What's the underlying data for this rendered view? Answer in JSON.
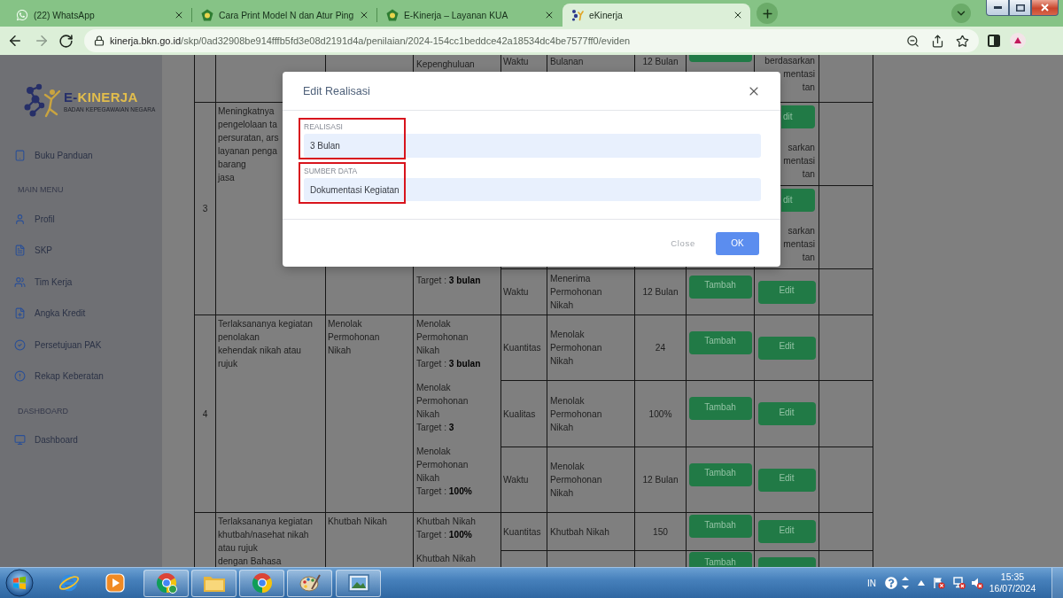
{
  "browser": {
    "tabs": [
      {
        "title": "(22) WhatsApp",
        "selected": false
      },
      {
        "title": "Cara Print Model N dan Atur Ping",
        "selected": false
      },
      {
        "title": "E-Kinerja – Layanan KUA",
        "selected": false
      },
      {
        "title": "eKinerja",
        "selected": true
      }
    ],
    "url": {
      "host": "kinerja.bkn.go.id",
      "path": "/skp/0ad32908be914fffb5fd3e08d2191d4a/penilaian/2024-154cc1beddce42a18534dc4be7577ff0/eviden"
    }
  },
  "sidebar": {
    "logo": {
      "title_parts": [
        {
          "text": "E-",
          "color": "#27306a"
        },
        {
          "text": "KINERJA",
          "color": "#e2bd4c"
        }
      ],
      "subtitle": "BADAN KEPEGAWAIAN NEGARA"
    },
    "items": [
      {
        "kind": "link",
        "label": "Buku Panduan"
      },
      {
        "kind": "header",
        "label": "MAIN MENU"
      },
      {
        "kind": "link",
        "label": "Profil"
      },
      {
        "kind": "link",
        "label": "SKP"
      },
      {
        "kind": "link",
        "label": "Tim Kerja"
      },
      {
        "kind": "link",
        "label": "Angka Kredit"
      },
      {
        "kind": "link",
        "label": "Persetujuan PAK"
      },
      {
        "kind": "link",
        "label": "Rekap Keberatan"
      },
      {
        "kind": "header",
        "label": "DASHBOARD"
      },
      {
        "kind": "link",
        "label": "Dashboard"
      }
    ]
  },
  "table": {
    "rows": [
      {
        "indicators": {
          "items": [
            {
              "name": "Kepenghuluan"
            }
          ]
        },
        "subrows": [
          {
            "aspect": "Waktu",
            "indicator": "Bulanan",
            "target": "12 Bulan",
            "actions": [
              {
                "kind": "add"
              }
            ],
            "note": {
              "lines": [
                "berdasarkan",
                "mentasi",
                "tan"
              ],
              "clipped": true
            }
          }
        ]
      },
      {
        "number": "3",
        "goal": "Meningkatnya\npengelolaan ta\npersuratan, ars\nlayanan penga\nbarang\njasa",
        "indicators": {
          "clipped": true,
          "items": [
            {
              "target": "Target : **3 bulan**"
            }
          ]
        },
        "subrows": [
          {
            "actions": [
              {
                "kind": "edit",
                "label": "dit",
                "clipped": true
              }
            ],
            "note": {
              "lines": [
                "sarkan",
                "mentasi",
                "tan"
              ],
              "clipped": true
            }
          },
          {
            "actions": [
              {
                "kind": "edit",
                "label": "dit",
                "clipped": true
              }
            ],
            "note": {
              "lines": [
                "sarkan",
                "mentasi",
                "tan"
              ],
              "clipped": true
            }
          },
          {
            "aspect": "Waktu",
            "indicator": "Menerima Permohonan Nikah",
            "target": "12 Bulan",
            "actions": [
              {
                "kind": "add",
                "label": "Tambah"
              },
              {
                "kind": "edit",
                "label": "Edit"
              }
            ]
          }
        ]
      },
      {
        "number": "4",
        "goal": "Terlaksananya kegiatan penolakan\nkehendak nikah atau rujuk",
        "activity": "Menolak Permohonan Nikah",
        "indicators": {
          "items": [
            {
              "name": "Menolak Permohonan Nikah",
              "target": "Target : **3 bulan**"
            },
            {
              "name": "Menolak Permohonan Nikah",
              "target": "Target : **3**"
            },
            {
              "name": "Menolak Permohonan Nikah",
              "target": "Target : **100%**"
            }
          ]
        },
        "subrows": [
          {
            "aspect": "Kuantitas",
            "indicator": "Menolak Permohonan Nikah",
            "target": "24",
            "actions": [
              {
                "kind": "add",
                "label": "Tambah"
              },
              {
                "kind": "edit",
                "label": "Edit"
              }
            ]
          },
          {
            "aspect": "Kualitas",
            "indicator": "Menolak Permohonan Nikah",
            "target": "100%",
            "actions": [
              {
                "kind": "add",
                "label": "Tambah"
              },
              {
                "kind": "edit",
                "label": "Edit"
              }
            ]
          },
          {
            "aspect": "Waktu",
            "indicator": "Menolak Permohonan Nikah",
            "target": "12 Bulan",
            "actions": [
              {
                "kind": "add",
                "label": "Tambah"
              },
              {
                "kind": "edit",
                "label": "Edit"
              }
            ]
          }
        ]
      },
      {
        "goal": "Terlaksananya kegiatan khutbah/nasehat nikah atau rujuk\ndengan Bahasa",
        "activity": "Khutbah Nikah",
        "indicators": {
          "items": [
            {
              "name": "Khutbah Nikah",
              "target": "Target : **100%**"
            },
            {
              "name": "Khutbah Nikah"
            }
          ]
        },
        "subrows": [
          {
            "aspect": "Kuantitas",
            "indicator": "Khutbah Nikah",
            "target": "150",
            "actions": [
              {
                "kind": "add",
                "label": "Tambah"
              },
              {
                "kind": "edit",
                "label": "Edit"
              }
            ]
          },
          {
            "actions": [
              {
                "kind": "add",
                "label": "Tambah"
              },
              {
                "kind": "edit"
              }
            ]
          }
        ]
      }
    ]
  },
  "dialog": {
    "title": "Edit Realisasi",
    "fields": [
      {
        "label": "REALISASI",
        "value": "3 Bulan",
        "highlighted": true
      },
      {
        "label": "SUMBER DATA",
        "value": "Dokumentasi Kegiatan",
        "highlighted": true
      }
    ],
    "buttons": [
      {
        "kind": "text",
        "label": "Close"
      },
      {
        "kind": "primary",
        "label": "OK"
      }
    ]
  },
  "taskbar": {
    "language": "IN",
    "time": "15:35",
    "date": "16/07/2024"
  }
}
